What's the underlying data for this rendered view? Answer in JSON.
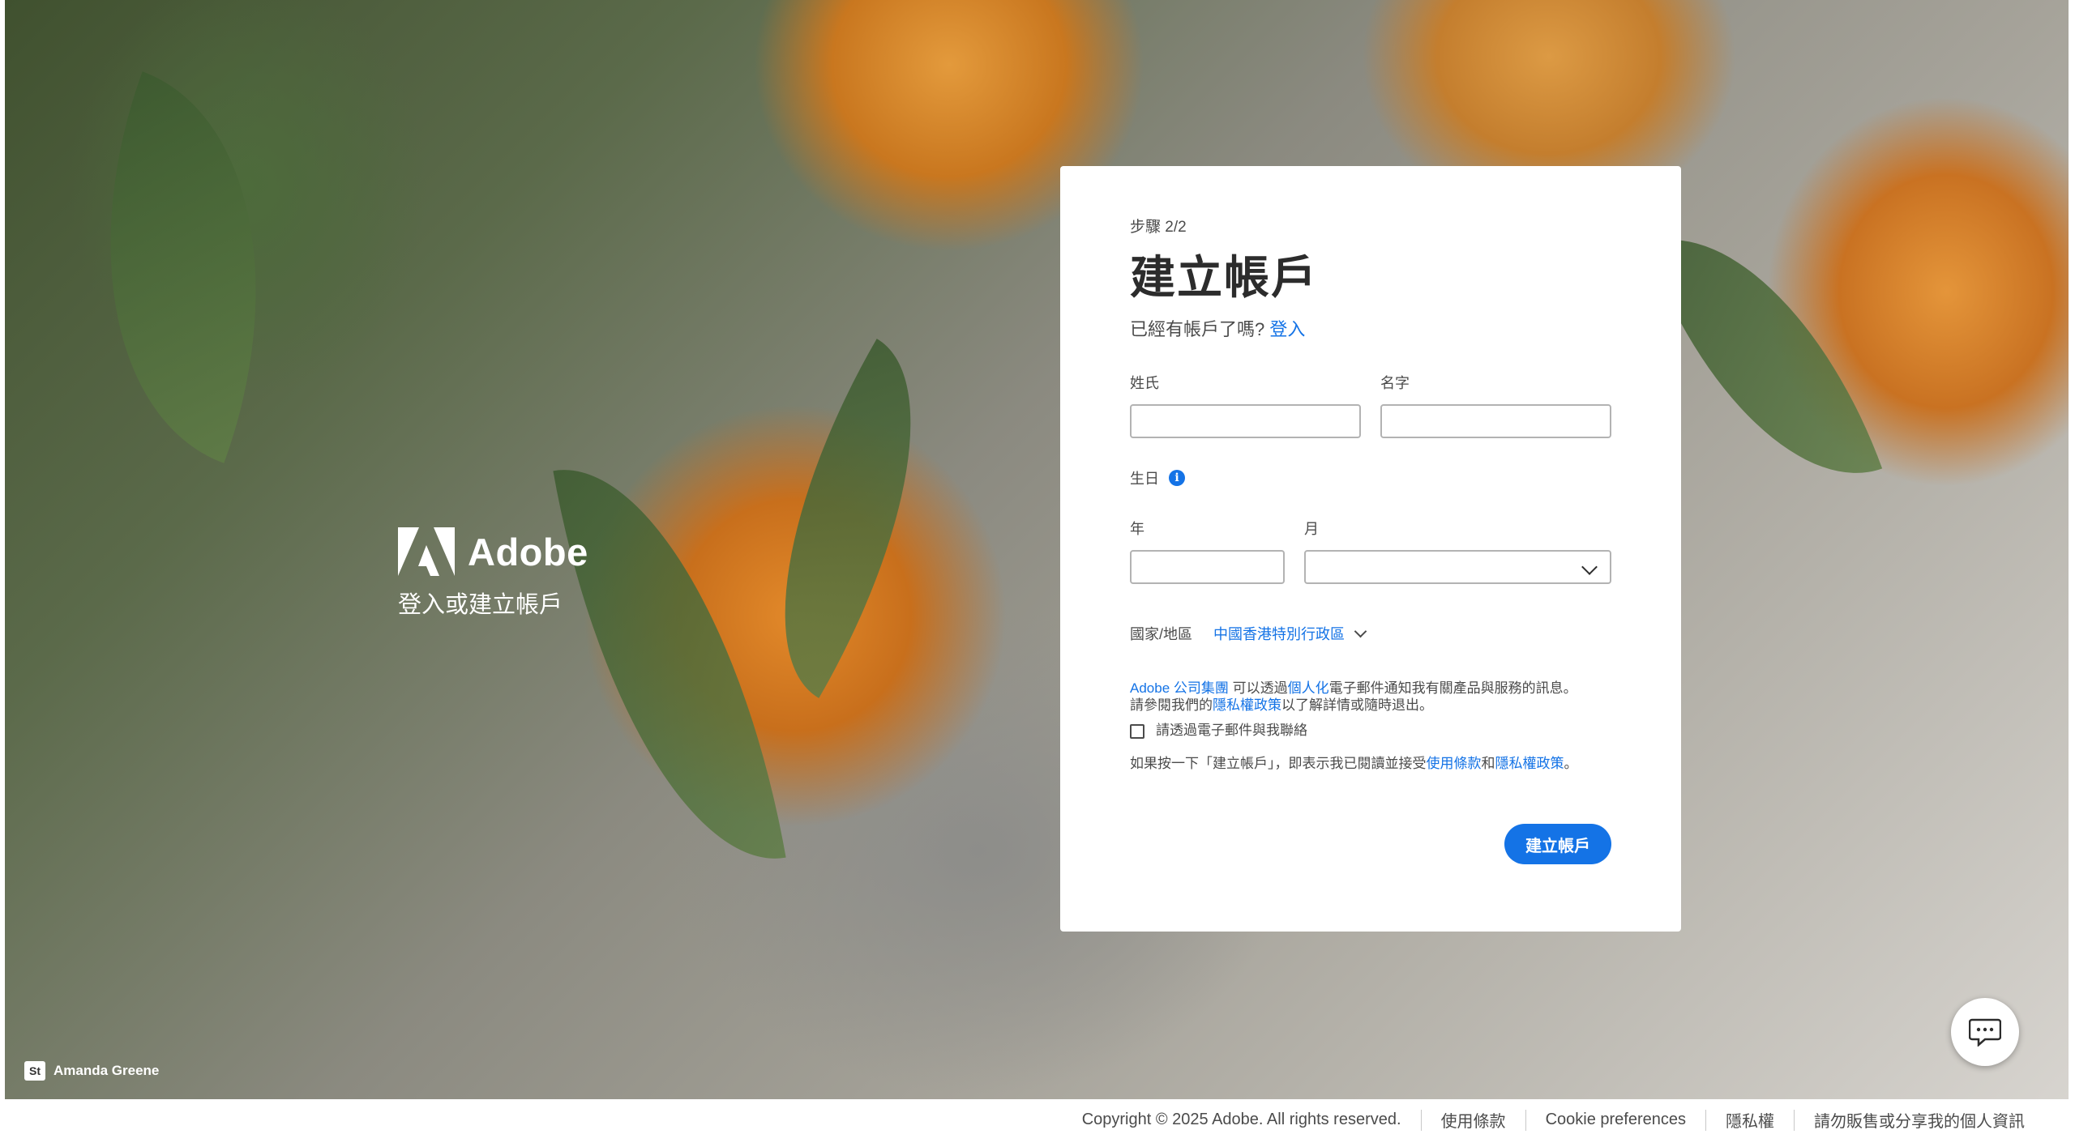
{
  "brand": {
    "name": "Adobe",
    "tagline": "登入或建立帳戶"
  },
  "photo_credit": {
    "badge": "St",
    "name": "Amanda Greene"
  },
  "form": {
    "step": "步驟 2/2",
    "title": "建立帳戶",
    "already_have_account": "已經有帳戶了嗎?",
    "sign_in_link": "登入",
    "last_name_label": "姓氏",
    "first_name_label": "名字",
    "birthday_label": "生日",
    "year_label": "年",
    "month_label": "月",
    "country_label": "國家/地區",
    "country_value": "中國香港特別行政區",
    "notice": {
      "company_link": "Adobe 公司集團",
      "text1": " 可以透過",
      "personalized_link": "個人化",
      "text2": "電子郵件通知我有關產品與服務的訊息。",
      "text3": "請參閱我們的",
      "privacy_link": "隱私權政策",
      "text4": "以了解詳情或隨時退出。"
    },
    "consent_label": "請透過電子郵件與我聯絡",
    "terms": {
      "text1": "如果按一下「建立帳戶」，即表示我已閱讀並接受",
      "terms_link": "使用條款",
      "and": "和",
      "privacy_link": "隱私權政策",
      "period": "。"
    },
    "submit_label": "建立帳戶"
  },
  "footer": {
    "copyright": "Copyright © 2025 Adobe. All rights reserved.",
    "terms": "使用條款",
    "cookie": "Cookie preferences",
    "privacy": "隱私權",
    "do_not_sell": "請勿販售或分享我的個人資訊"
  },
  "colors": {
    "accent": "#1473e6",
    "text": "#2c2c2c"
  }
}
